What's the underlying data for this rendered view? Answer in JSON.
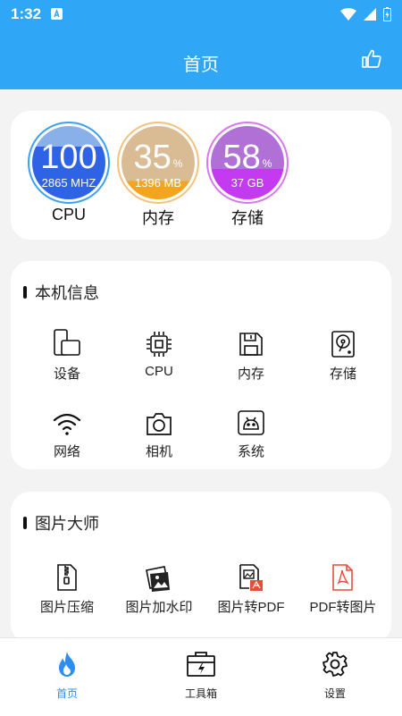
{
  "statusbar": {
    "time": "1:32"
  },
  "appbar": {
    "title": "首页"
  },
  "gauges": [
    {
      "value": "100",
      "unit": "%",
      "detail": "2865 MHZ",
      "label": "CPU",
      "percent": 100
    },
    {
      "value": "35",
      "unit": "%",
      "detail": "1396 MB",
      "label": "内存",
      "percent": 35
    },
    {
      "value": "58",
      "unit": "%",
      "detail": "37 GB",
      "label": "存储",
      "percent": 58
    }
  ],
  "device_section": {
    "title": "本机信息",
    "items": [
      {
        "label": "设备",
        "icon": "device-icon"
      },
      {
        "label": "CPU",
        "icon": "cpu-chip-icon"
      },
      {
        "label": "内存",
        "icon": "memory-save-icon"
      },
      {
        "label": "存储",
        "icon": "hard-disk-icon"
      },
      {
        "label": "网络",
        "icon": "wifi-icon"
      },
      {
        "label": "相机",
        "icon": "camera-icon"
      },
      {
        "label": "系统",
        "icon": "android-icon"
      }
    ]
  },
  "image_section": {
    "title": "图片大师",
    "items": [
      {
        "label": "图片压缩",
        "icon": "zip-file-icon"
      },
      {
        "label": "图片加水印",
        "icon": "watermark-icon"
      },
      {
        "label": "图片转PDF",
        "icon": "image-to-pdf-icon"
      },
      {
        "label": "PDF转图片",
        "icon": "pdf-to-image-icon"
      }
    ]
  },
  "bottom_nav": [
    {
      "label": "首页",
      "icon": "flame-icon",
      "active": true
    },
    {
      "label": "工具箱",
      "icon": "toolbox-icon",
      "active": false
    },
    {
      "label": "设置",
      "icon": "gear-icon",
      "active": false
    }
  ],
  "colors": {
    "primary": "#30a6f7",
    "cpu_fill": "#2f63e6",
    "memory_fill": "#f3a51f",
    "storage_fill": "#c43af0",
    "active_nav": "#2d8ef0"
  }
}
